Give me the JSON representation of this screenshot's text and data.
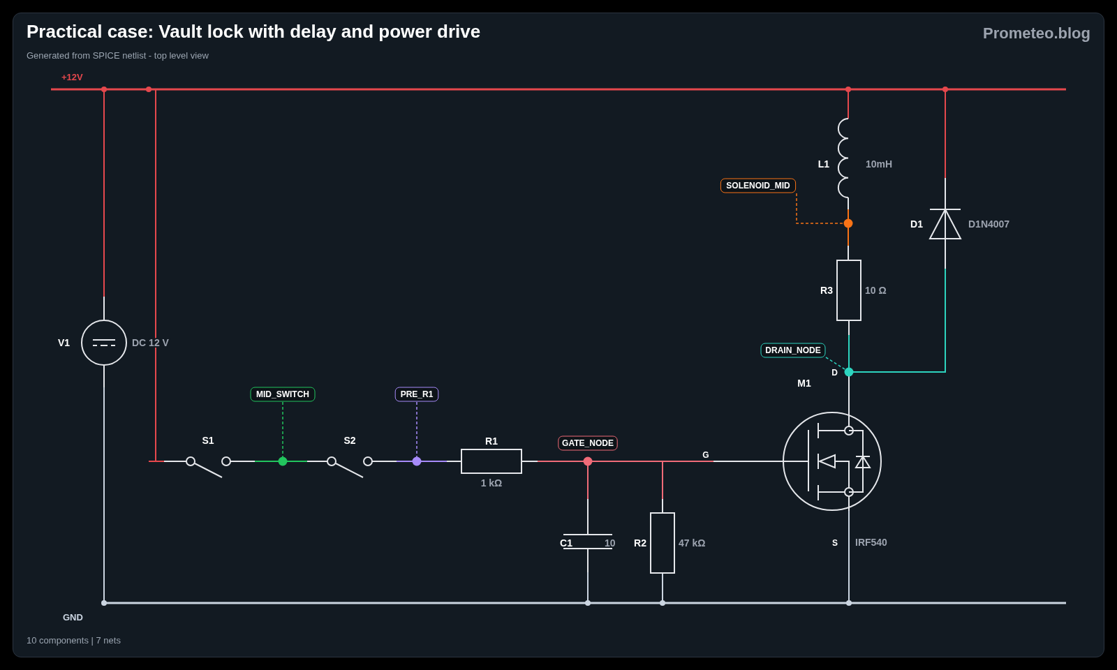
{
  "header": {
    "title": "Practical case: Vault lock with delay and power drive",
    "subtitle": "Generated from SPICE netlist - top level view",
    "brand": "Prometeo.blog"
  },
  "rails": [
    {
      "label": "+12V",
      "color": "#e5484d"
    },
    {
      "label": "GND",
      "color": "#cbd5e1"
    }
  ],
  "components": [
    {
      "kind": "inductor",
      "ref": "L1",
      "value": "10mH"
    },
    {
      "kind": "diode",
      "ref": "D1",
      "value": "D1N4007"
    },
    {
      "kind": "resistor",
      "ref": "R3",
      "value": "10 Ω"
    },
    {
      "kind": "source",
      "ref": "V1",
      "value": "DC 12 V"
    },
    {
      "kind": "mosfet",
      "ref": "M1",
      "value": "IRF540",
      "pins": [
        "D",
        "G",
        "S"
      ]
    },
    {
      "kind": "switch",
      "ref": "S1"
    },
    {
      "kind": "switch",
      "ref": "S2"
    },
    {
      "kind": "resistor",
      "ref": "R1",
      "value": "1 kΩ"
    },
    {
      "kind": "capacitor",
      "ref": "C1",
      "value": "10"
    },
    {
      "kind": "resistor",
      "ref": "R2",
      "value": "47 kΩ"
    }
  ],
  "nets": [
    {
      "label": "SOLENOID_MID",
      "color": "#f97316"
    },
    {
      "label": "DRAIN_NODE",
      "color": "#2dd4bf"
    },
    {
      "label": "MID_SWITCH",
      "color": "#22c55e"
    },
    {
      "label": "PRE_R1",
      "color": "#a78bfa"
    },
    {
      "label": "GATE_NODE",
      "color": "#f06b78"
    }
  ],
  "footer": "10 components | 7 nets"
}
